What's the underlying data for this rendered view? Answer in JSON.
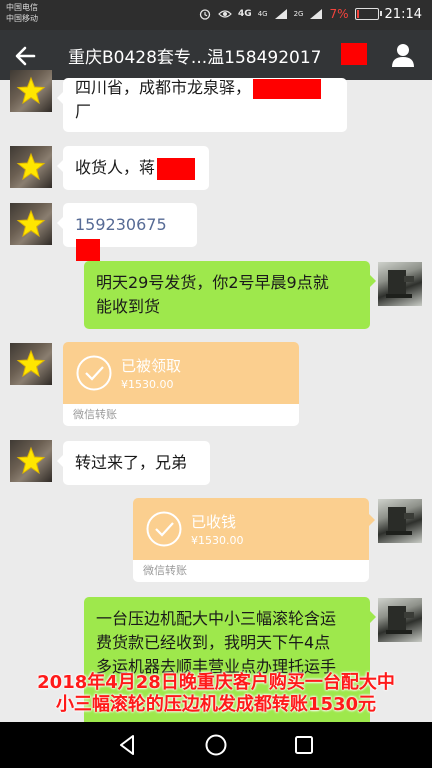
{
  "status_bar": {
    "carrier_1": "中国电信",
    "carrier_2": "中国移动",
    "network_1": "4G",
    "network_2": "4G",
    "network_3": "2G",
    "battery_percent": "7%",
    "time": "21:14",
    "battery_level": 0.07
  },
  "header": {
    "title": "重庆B0428套专...温158492017"
  },
  "messages": [
    {
      "side": "left",
      "text": "四川省，成都市龙泉驿，",
      "text_2": "厂"
    },
    {
      "side": "left",
      "text": "收货人，蒋"
    },
    {
      "side": "left",
      "text": "159230675"
    },
    {
      "side": "right",
      "text": "明天29号发货，你2号早晨9点就",
      "text_2": "能收到货"
    },
    {
      "side": "left",
      "type": "transfer",
      "status": "已被领取",
      "amount": "¥1530.00",
      "footer": "微信转账"
    },
    {
      "side": "left",
      "text": "转过来了，兄弟"
    },
    {
      "side": "right",
      "type": "transfer",
      "status": "已收钱",
      "amount": "¥1530.00",
      "footer": "微信转账"
    },
    {
      "side": "right",
      "text": "一台压边机配大中小三幅滚轮含运",
      "text_2": "费货款已经收到，我明天下午4点",
      "text_3": "多运机器去顺丰营业点办理托运手"
    }
  ],
  "caption": {
    "line_1": "2018年4月28日晚重庆客户购买一台配大中",
    "line_2": "小三幅滚轮的压边机发成都转账1530元"
  },
  "colors": {
    "title_bar": "#333537",
    "chat_bg": "#ebebeb",
    "bubble_green": "#9ee84c",
    "transfer_orange": "#fbcf8f",
    "redaction": "#ff0000",
    "caption_text": "#ff1a1a"
  }
}
